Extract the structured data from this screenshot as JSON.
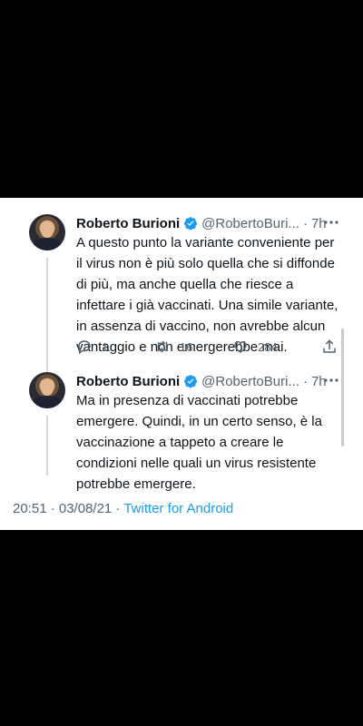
{
  "tweets": [
    {
      "name": "Roberto Burioni",
      "handle": "@RobertoBuri...",
      "time": "7h",
      "text": "A questo punto la variante conveniente per il virus non è più solo quella che si diffonde di più, ma anche quella che riesce a infettare i già vaccinati. Una simile variante, in assenza di vaccino, non avrebbe alcun vantaggio e non emergerebbe mai.",
      "replies": "1",
      "retweets": "16",
      "likes": "284"
    },
    {
      "name": "Roberto Burioni",
      "handle": "@RobertoBuri...",
      "time": "7h",
      "text": "Ma in presenza di vaccinati potrebbe emergere. Quindi, in un certo senso, è la vaccinazione a tappeto a creare le condizioni nelle quali un virus resistente potrebbe emergere."
    }
  ],
  "meta": {
    "timestamp": "20:51 · 03/08/21 · ",
    "source": "Twitter for Android"
  },
  "colors": {
    "verified": "#1d9bf0",
    "link": "#1d9bf0",
    "secondary": "#536471"
  },
  "icons": [
    "verified-badge-icon",
    "more-icon",
    "reply-icon",
    "retweet-icon",
    "like-icon",
    "share-icon"
  ]
}
